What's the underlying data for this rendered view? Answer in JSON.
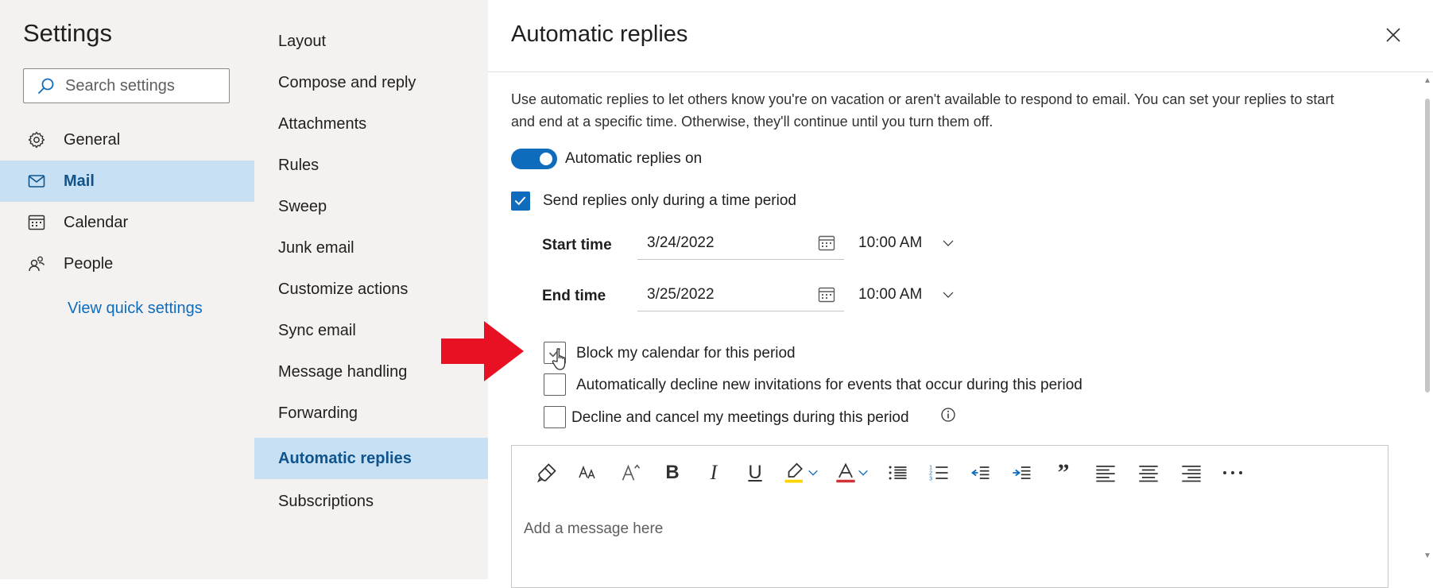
{
  "settings": {
    "title": "Settings",
    "search_placeholder": "Search settings",
    "nav": [
      {
        "label": "General",
        "icon": "gear-icon",
        "active": false
      },
      {
        "label": "Mail",
        "icon": "mail-icon",
        "active": true
      },
      {
        "label": "Calendar",
        "icon": "calendar-icon",
        "active": false
      },
      {
        "label": "People",
        "icon": "people-icon",
        "active": false
      }
    ],
    "quick_settings": "View quick settings"
  },
  "mail_nav": [
    "Layout",
    "Compose and reply",
    "Attachments",
    "Rules",
    "Sweep",
    "Junk email",
    "Customize actions",
    "Sync email",
    "Message handling",
    "Forwarding",
    "Automatic replies",
    "Subscriptions"
  ],
  "mail_nav_active": "Automatic replies",
  "main": {
    "title": "Automatic replies",
    "description": "Use automatic replies to let others know you're on vacation or aren't available to respond to email. You can set your replies to start and end at a specific time. Otherwise, they'll continue until you turn them off.",
    "toggle_label": "Automatic replies on",
    "toggle_on": true,
    "time_period_label": "Send replies only during a time period",
    "start_label": "Start time",
    "start_date": "3/24/2022",
    "start_time": "10:00 AM",
    "end_label": "End time",
    "end_date": "3/25/2022",
    "end_time": "10:00 AM",
    "block_calendar_label": "Block my calendar for this period",
    "decline_invitations_label": "Automatically decline new invitations for events that occur during this period",
    "decline_cancel_label": "Decline and cancel my meetings during this period",
    "message_placeholder": "Add a message here"
  },
  "colors": {
    "accent": "#0f6cbd",
    "nav_active_bg": "#c7e0f4",
    "panel_bg": "#f3f2f1",
    "arrow": "#e81123",
    "highlight": "#ffd400",
    "font_color": "#d13438"
  }
}
